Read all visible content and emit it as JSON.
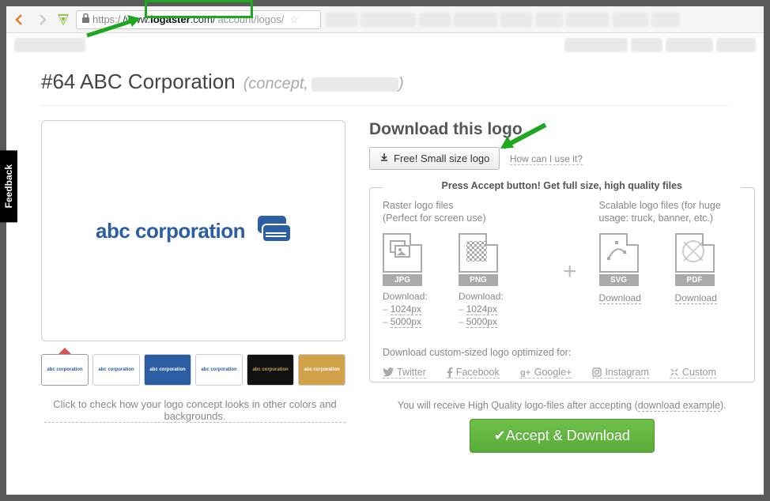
{
  "browser": {
    "url_https": "https:/",
    "url_domain_pre": "/www.",
    "url_domain_bold": "logaster",
    "url_domain_post": ".com/",
    "url_rest": "account/logos/"
  },
  "feedback": "Feedback",
  "page": {
    "title": "#64 ABC Corporation",
    "concept": "(concept,",
    "concept_close": ")",
    "logo_name": "abc corporation"
  },
  "caption": "Click to check how your logo concept looks in other colors and backgrounds.",
  "thumbs": [
    "abc corporation",
    "abc corporation",
    "abc corporation",
    "abc corporation",
    "abc corporation",
    "abc corporation"
  ],
  "right": {
    "heading": "Download this logo",
    "free_btn": "Free! Small size logo",
    "how": "How can I use it?",
    "box_title": "Press Accept button! Get full size, high quality files",
    "raster_title": "Raster logo files",
    "raster_sub": "(Perfect for screen use)",
    "scalable_title": "Scalable logo files (for huge usage: truck, banner, etc.)",
    "download_label": "Download:",
    "download_link": "Download",
    "sizes": [
      "1024px",
      "5000px"
    ],
    "formats": {
      "jpg": "JPG",
      "png": "PNG",
      "svg": "SVG",
      "pdf": "PDF"
    },
    "custom_label": "Download custom-sized logo optimized for:",
    "social": [
      "Twitter",
      "Facebook",
      "Google+",
      "Instagram",
      "Custom"
    ],
    "note_pre": "You will receive High Quality logo-files after accepting (",
    "note_link": "download example",
    "note_post": ").",
    "accept": "Accept & Download"
  }
}
